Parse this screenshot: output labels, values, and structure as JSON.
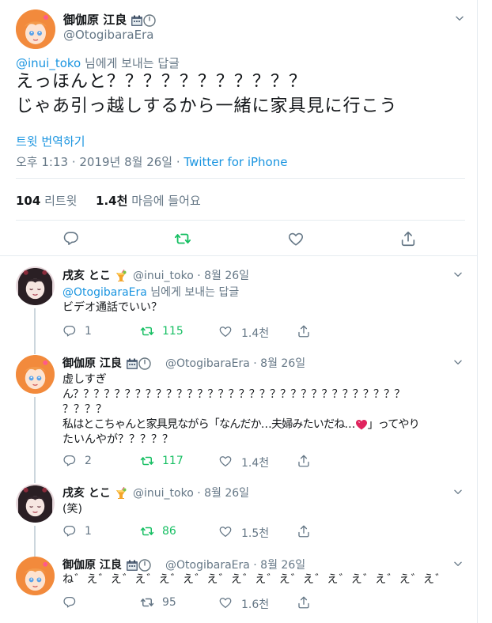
{
  "main_tweet": {
    "display_name": "御伽原 江良",
    "handle": "@OtogibaraEra",
    "reply_to_handle": "@inui_toko",
    "reply_to_suffix": " 님에게 보내는 답글",
    "text_line1": "えっほんと？？？？？？？？？？？",
    "text_line2": "じゃあ引っ越しするから一緒に家具見に行こう",
    "translate_label": "트윗 번역하기",
    "timestamp": "오후 1:13 · 2019년 8월 26일 · ",
    "source": "Twitter for iPhone",
    "retweet_count": "104",
    "retweet_label": " 리트윗",
    "like_count": "1.4천",
    "like_label": " 마음에 들어요",
    "retweeted": true
  },
  "replies": [
    {
      "display_name": "戌亥 とこ",
      "handle_date": "@inui_toko · 8월 26일",
      "reply_to_handle": "@OtogibaraEra",
      "reply_to_suffix": " 님에게 보내는 답글",
      "lines": [
        "ビデオ通話でいい？"
      ],
      "reply_count": "1",
      "retweet_count": "115",
      "like_count": "1.4천",
      "retweeted": true
    },
    {
      "display_name": "御伽原 江良",
      "handle_date": "@OtogibaraEra · 8월 26일",
      "lines": [
        "虚しすぎ",
        "ん？？？？？？？？？？？？？？？？？？？？？？？？？？？？？？？？",
        "？？？？",
        "私はとこちゃんと家具見ながら「なんだか…夫婦みたいだね…",
        "たいんやが？？？？？"
      ],
      "line4_suffix": "」ってやり",
      "reply_count": "2",
      "retweet_count": "117",
      "like_count": "1.4천",
      "retweeted": true
    },
    {
      "display_name": "戌亥 とこ",
      "handle_date": "@inui_toko · 8월 26일",
      "lines": [
        "(笑)"
      ],
      "reply_count": "1",
      "retweet_count": "86",
      "like_count": "1.5천",
      "retweeted": true
    },
    {
      "display_name": "御伽原 江良",
      "handle_date": "@OtogibaraEra · 8월 26일",
      "lines": [
        "ね゛え゛え゛え゛え゛え゛え゛え゛え゛え゛え゛え゛え゛え゛え゛え゛"
      ],
      "reply_count": "",
      "retweet_count": "95",
      "like_count": "1.6천",
      "retweeted": false
    }
  ],
  "colors": {
    "link_blue": "#1b95e0",
    "retweet_green": "#17bf63",
    "muted_gray": "#657786",
    "heart_red": "#e0245e"
  },
  "icons": [
    "chevron-down-icon",
    "reply-icon",
    "retweet-icon",
    "like-icon",
    "share-icon",
    "calendar-icon",
    "clock-icon",
    "drink-icon",
    "heart-emoji-icon"
  ]
}
